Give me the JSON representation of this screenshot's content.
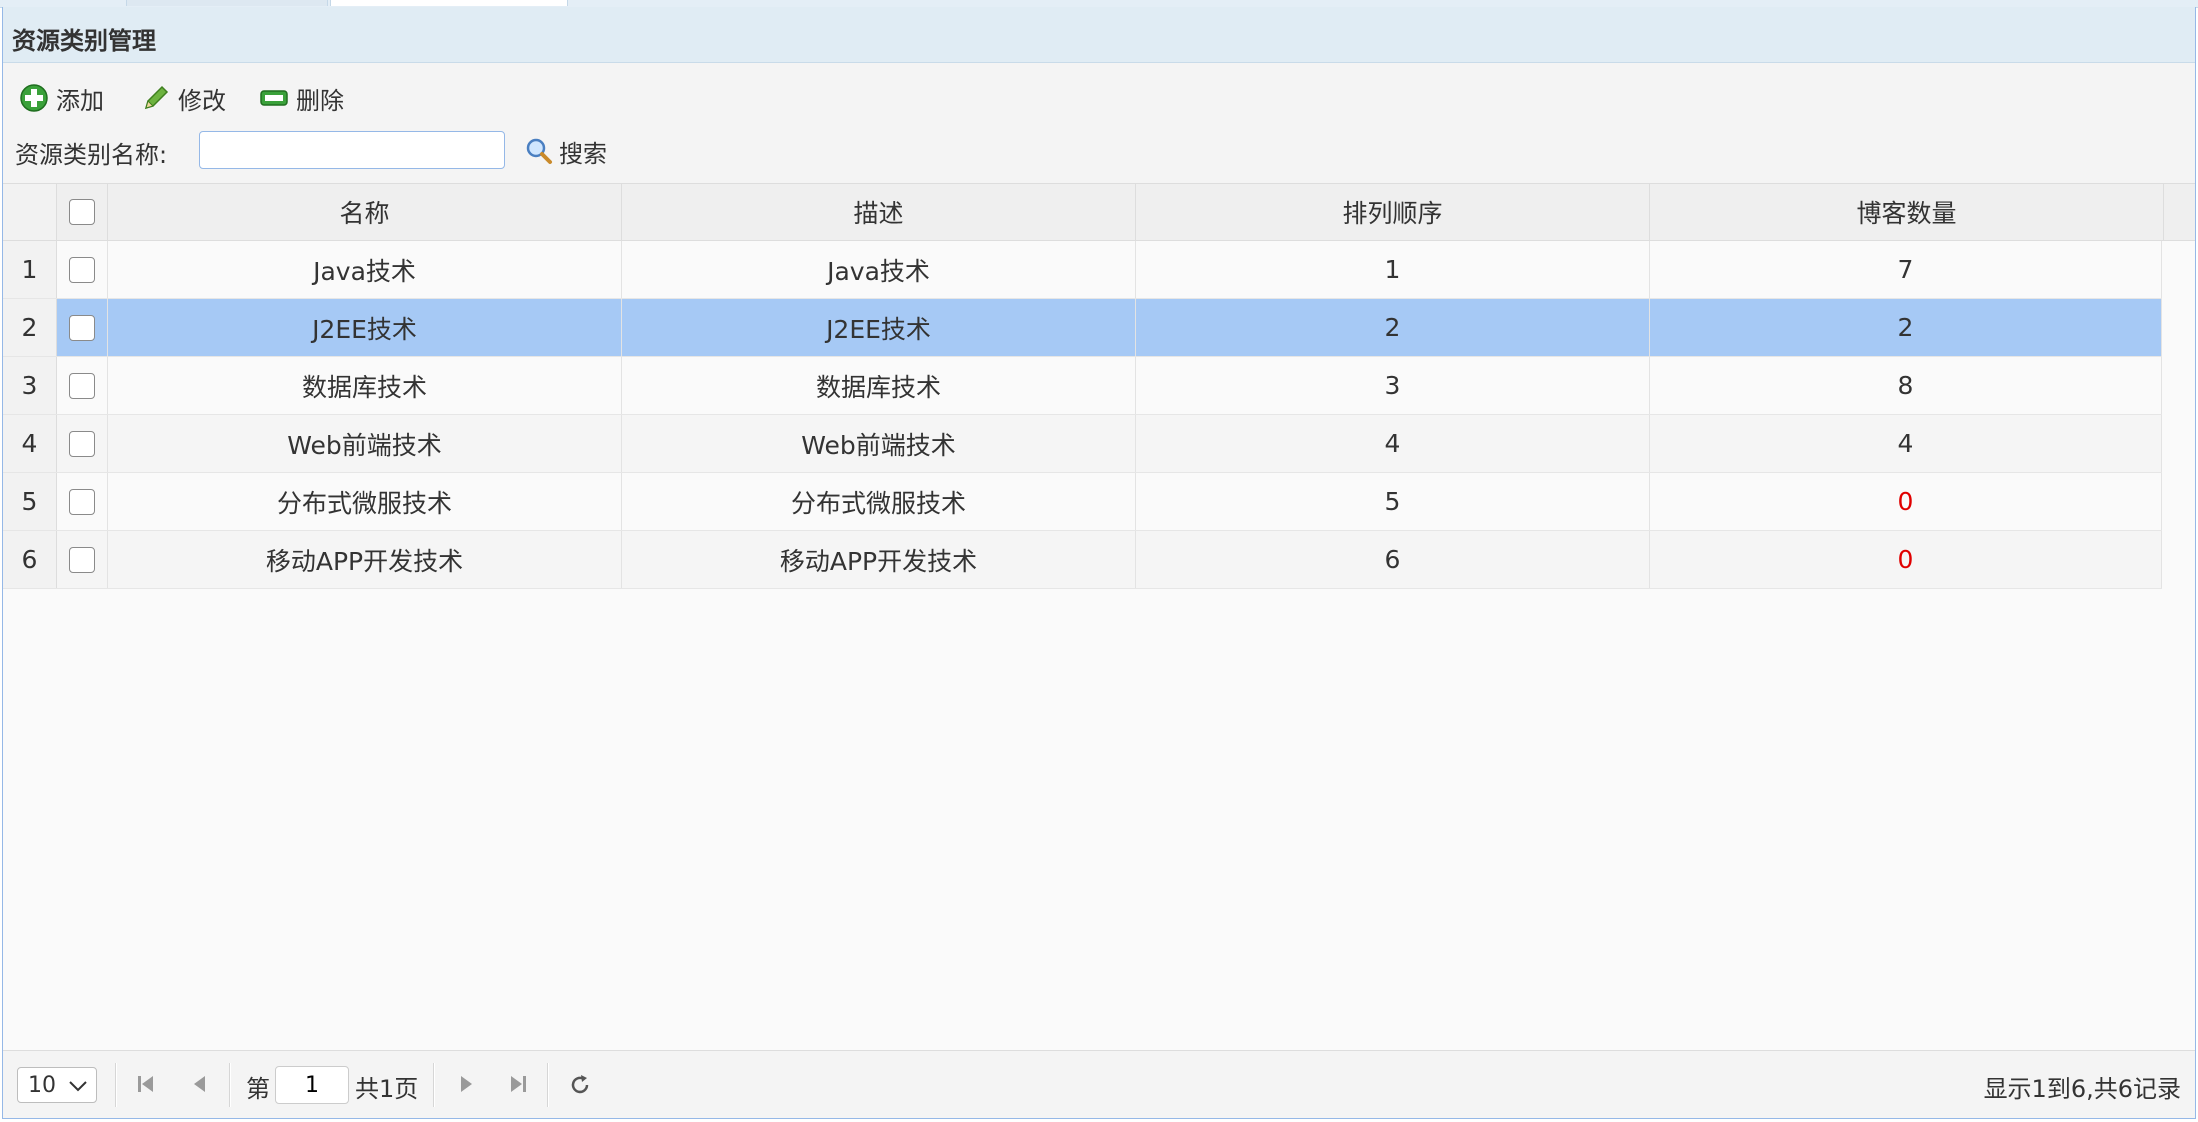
{
  "panel": {
    "title": "资源类别管理"
  },
  "toolbar": {
    "add_label": "添加",
    "edit_label": "修改",
    "delete_label": "删除",
    "search_label": "资源类别名称:",
    "search_value": "",
    "search_button": "搜索"
  },
  "grid": {
    "columns": [
      "名称",
      "描述",
      "排列顺序",
      "博客数量"
    ],
    "rows": [
      {
        "num": "1",
        "name": "Java技术",
        "desc": "Java技术",
        "order": "1",
        "count": "7"
      },
      {
        "num": "2",
        "name": "J2EE技术",
        "desc": "J2EE技术",
        "order": "2",
        "count": "2"
      },
      {
        "num": "3",
        "name": "数据库技术",
        "desc": "数据库技术",
        "order": "3",
        "count": "8"
      },
      {
        "num": "4",
        "name": "Web前端技术",
        "desc": "Web前端技术",
        "order": "4",
        "count": "4"
      },
      {
        "num": "5",
        "name": "分布式微服技术",
        "desc": "分布式微服技术",
        "order": "5",
        "count": "0"
      },
      {
        "num": "6",
        "name": "移动APP开发技术",
        "desc": "移动APP开发技术",
        "order": "6",
        "count": "0"
      }
    ],
    "selected_row": 2
  },
  "pager": {
    "page_size": "10",
    "page_prefix": "第",
    "page_value": "1",
    "page_total": "共1页",
    "info": "显示1到6,共6记录"
  },
  "colors": {
    "selected_row": "#a6c9f5",
    "header_bg": "#e0ecf4",
    "zero_count": "#e00000"
  },
  "icons": {
    "add": "plus-icon",
    "edit": "pencil-icon",
    "delete": "minus-icon",
    "search": "magnifier-icon"
  }
}
